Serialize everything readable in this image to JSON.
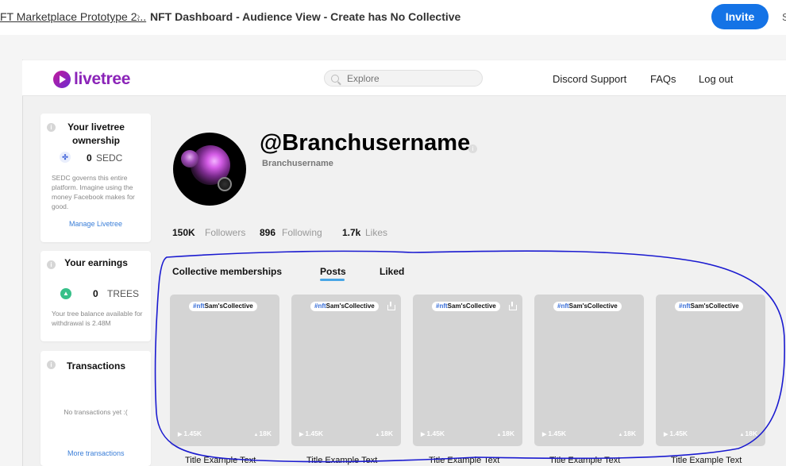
{
  "breadcrumb": {
    "project": "FT Marketplace Prototype 2...",
    "separator": "›",
    "page": "NFT Dashboard - Audience View - Create has No Collective"
  },
  "toolbar": {
    "invite_label": "Invite",
    "edge_char": "S"
  },
  "header": {
    "logo_text": "livetree",
    "search_placeholder": "Explore",
    "nav": [
      "Discord Support",
      "FAQs",
      "Log out"
    ]
  },
  "sidebar": {
    "ownership": {
      "title_line1": "Your livetree",
      "title_line2": "ownership",
      "amount": "0",
      "unit": "SEDC",
      "description": "SEDC governs this entire platform. Imagine using the money Facebook makes for good.",
      "link": "Manage Livetree"
    },
    "earnings": {
      "title": "Your earnings",
      "amount": "0",
      "unit": "TREES",
      "description": "Your tree balance available for withdrawal is 2.48M"
    },
    "transactions": {
      "title": "Transactions",
      "empty": "No transactions yet :(",
      "link": "More transactions"
    }
  },
  "profile": {
    "username": "@Branchusername",
    "handle": "Branchusername",
    "stats": [
      {
        "value": "150K",
        "label": "Followers"
      },
      {
        "value": "896",
        "label": "Following"
      },
      {
        "value": "1.7k",
        "label": "Likes"
      }
    ]
  },
  "tabs": [
    {
      "label": "Collective memberships",
      "active": false
    },
    {
      "label": "Posts",
      "active": true
    },
    {
      "label": "Liked",
      "active": false
    }
  ],
  "posts": [
    {
      "tag_hash": "#nft",
      "tag_name": "Sam'sCollective",
      "plays": "1.45K",
      "trees": "18K",
      "title": "Title Example Text"
    },
    {
      "tag_hash": "#nft",
      "tag_name": "Sam'sCollective",
      "plays": "1.45K",
      "trees": "18K",
      "title": "Title Example Text"
    },
    {
      "tag_hash": "#nft",
      "tag_name": "Sam'sCollective",
      "plays": "1.45K",
      "trees": "18K",
      "title": "Title Example Text"
    },
    {
      "tag_hash": "#nft",
      "tag_name": "Sam'sCollective",
      "plays": "1.45K",
      "trees": "18K",
      "title": "Title Example Text"
    },
    {
      "tag_hash": "#nft",
      "tag_name": "Sam'sCollective",
      "plays": "1.45K",
      "trees": "18K",
      "title": "Title Example Text"
    }
  ],
  "colors": {
    "accent": "#1473e6",
    "brand": "#8b24b8",
    "tab_underline": "#48a6e6",
    "annotation": "#1a1ad0"
  }
}
